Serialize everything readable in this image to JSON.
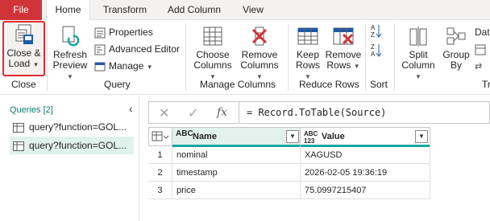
{
  "tabs": [
    {
      "label": "File"
    },
    {
      "label": "Home"
    },
    {
      "label": "Transform"
    },
    {
      "label": "Add Column"
    },
    {
      "label": "View"
    }
  ],
  "ribbon": {
    "close_load": {
      "line1": "Close &",
      "line2": "Load"
    },
    "close_group": "Close",
    "refresh": {
      "line1": "Refresh",
      "line2": "Preview"
    },
    "properties": "Properties",
    "advanced_editor": "Advanced Editor",
    "manage": "Manage",
    "query_group": "Query",
    "choose_columns": {
      "line1": "Choose",
      "line2": "Columns"
    },
    "remove_columns": {
      "line1": "Remove",
      "line2": "Columns"
    },
    "manage_columns_group": "Manage Columns",
    "keep_rows": {
      "line1": "Keep",
      "line2": "Rows"
    },
    "remove_rows": {
      "line1": "Remove",
      "line2": "Rows"
    },
    "reduce_rows_group": "Reduce Rows",
    "sort_group": "Sort",
    "split_column": {
      "line1": "Split",
      "line2": "Column"
    },
    "group_by": {
      "line1": "Group",
      "line2": "By"
    },
    "data_partial": "Dat",
    "tr_partial": "Tr"
  },
  "queries": {
    "title": "Queries [2]",
    "items": [
      {
        "label": "query?function=GOL..."
      },
      {
        "label": "query?function=GOL..."
      }
    ]
  },
  "formula": {
    "text": "= Record.ToTable(Source)"
  },
  "table": {
    "columns": [
      {
        "type": "ABC",
        "name": "Name"
      },
      {
        "type": "ABC\n123",
        "name": "Value"
      }
    ],
    "rows": [
      {
        "n": "1",
        "name": "nominal",
        "value": "XAGUSD"
      },
      {
        "n": "2",
        "name": "timestamp",
        "value": "2026-02-05 19:36:19"
      },
      {
        "n": "3",
        "name": "price",
        "value": "75.0997215407"
      }
    ]
  },
  "colors": {
    "file_tab": "#d13438",
    "accent_green": "#13a89e",
    "highlight_border": "#e02b2b"
  }
}
